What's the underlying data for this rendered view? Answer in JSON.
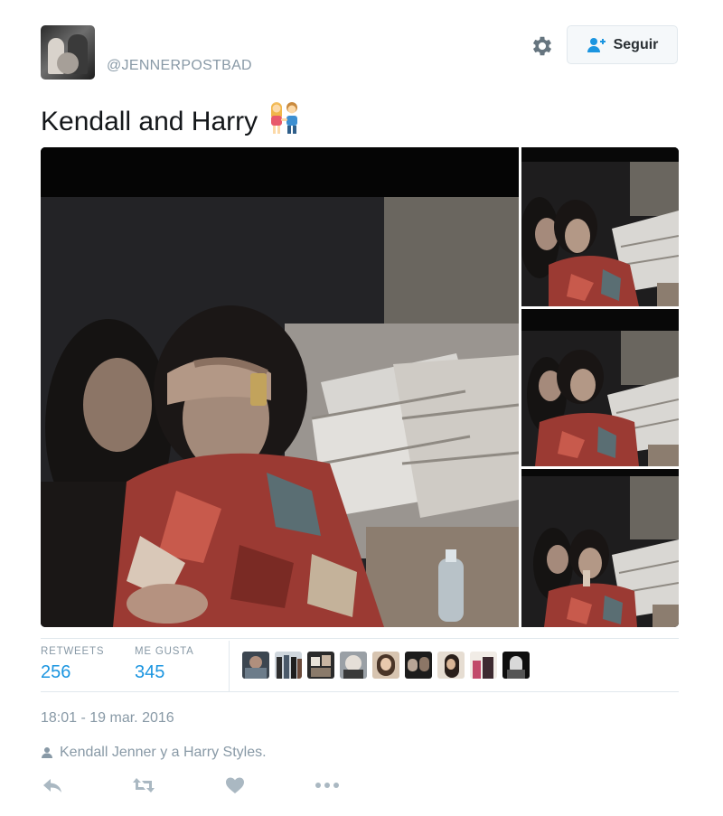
{
  "header": {
    "handle": "@JENNERPOSTBAD",
    "follow_label": "Seguir",
    "avatar_icon": "profile-photo",
    "settings_icon": "gear-icon",
    "follow_icon": "person-plus-icon"
  },
  "tweet": {
    "text": "Kendall and Harry",
    "emoji": "couple-emoji"
  },
  "media": {
    "photo_count": 4
  },
  "stats": {
    "retweets_label": "RETWEETS",
    "retweets_value": "256",
    "likes_label": "ME GUSTA",
    "likes_value": "345",
    "liker_avatar_count": 9
  },
  "meta": {
    "timestamp": "18:01 - 19 mar. 2016",
    "tagline": "Kendall Jenner y a Harry Styles.",
    "tagline_icon": "person-icon"
  },
  "actions": {
    "reply_icon": "reply-icon",
    "retweet_icon": "retweet-icon",
    "like_icon": "heart-icon",
    "more_icon": "more-icon"
  },
  "colors": {
    "link_blue": "#1b95e0",
    "muted": "#8899a6",
    "divider": "#e1e8ed",
    "action_gray": "#aab8c2"
  }
}
